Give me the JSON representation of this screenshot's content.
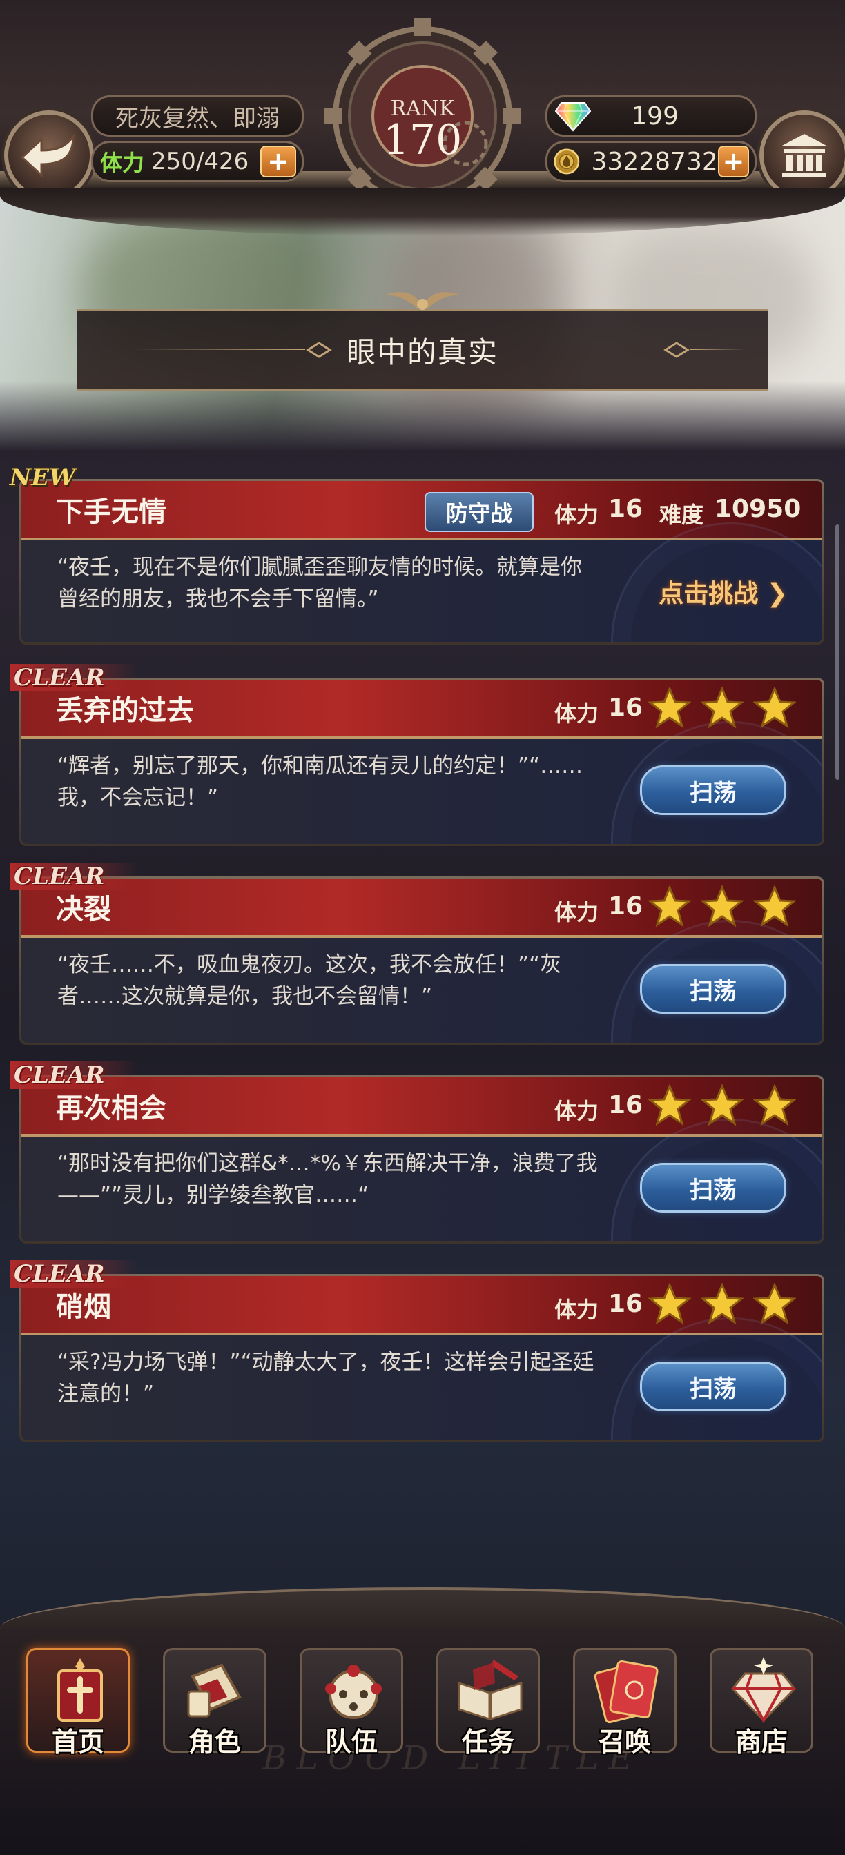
{
  "header": {
    "stage_name": "死灰复然、即溺",
    "stamina_label": "体力",
    "stamina_value": "250/426",
    "rank_label": "RANK",
    "rank_value": "170",
    "gems": "199",
    "gold": "33228732",
    "plus_label": "+"
  },
  "banner": {
    "title": "眼中的真实"
  },
  "stages": [
    {
      "tag": "NEW",
      "name": "下手无情",
      "mode": "防守战",
      "stamina_label": "体力",
      "stamina": "16",
      "difficulty_label": "难度",
      "difficulty": "10950",
      "desc": "“夜壬，现在不是你们腻腻歪歪聊友情的时候。就算是你曾经的朋友，我也不会手下留情。”",
      "action": "点击挑战 ❯"
    },
    {
      "tag": "CLEAR",
      "name": "丢弃的过去",
      "stamina_label": "体力",
      "stamina": "16",
      "stars": 3,
      "desc": "“辉者，别忘了那天，你和南瓜还有灵儿的约定！”“……我，不会忘记！”",
      "action": "扫荡"
    },
    {
      "tag": "CLEAR",
      "name": "决裂",
      "stamina_label": "体力",
      "stamina": "16",
      "stars": 3,
      "desc": "“夜壬……不，吸血鬼夜刃。这次，我不会放任！”“灰者……这次就算是你，我也不会留情！”",
      "action": "扫荡"
    },
    {
      "tag": "CLEAR",
      "name": "再次相会",
      "stamina_label": "体力",
      "stamina": "16",
      "stars": 3,
      "desc": "“那时没有把你们这群&*…*%￥东西解决干净，浪费了我——””灵儿，别学绫叁教官……“",
      "action": "扫荡"
    },
    {
      "tag": "CLEAR",
      "name": "硝烟",
      "stamina_label": "体力",
      "stamina": "16",
      "stars": 3,
      "desc": "“采?冯力场飞弹！”“动静太大了，夜壬！这样会引起圣廷注意的！”",
      "action": "扫荡"
    }
  ],
  "nav": [
    {
      "label": "首页",
      "active": true,
      "icon": "home-icon"
    },
    {
      "label": "角色",
      "icon": "character-card-icon"
    },
    {
      "label": "队伍",
      "icon": "team-icon"
    },
    {
      "label": "任务",
      "icon": "quest-book-icon"
    },
    {
      "label": "召唤",
      "icon": "summon-card-icon"
    },
    {
      "label": "商店",
      "icon": "shop-diamond-icon"
    }
  ],
  "watermark": "BLOOD LITTLE",
  "colors": {
    "accent_red": "#b12a27",
    "gold": "#f2d46a",
    "sweep_blue": "#2d5f9c",
    "stamina_green": "#8fe04a"
  }
}
